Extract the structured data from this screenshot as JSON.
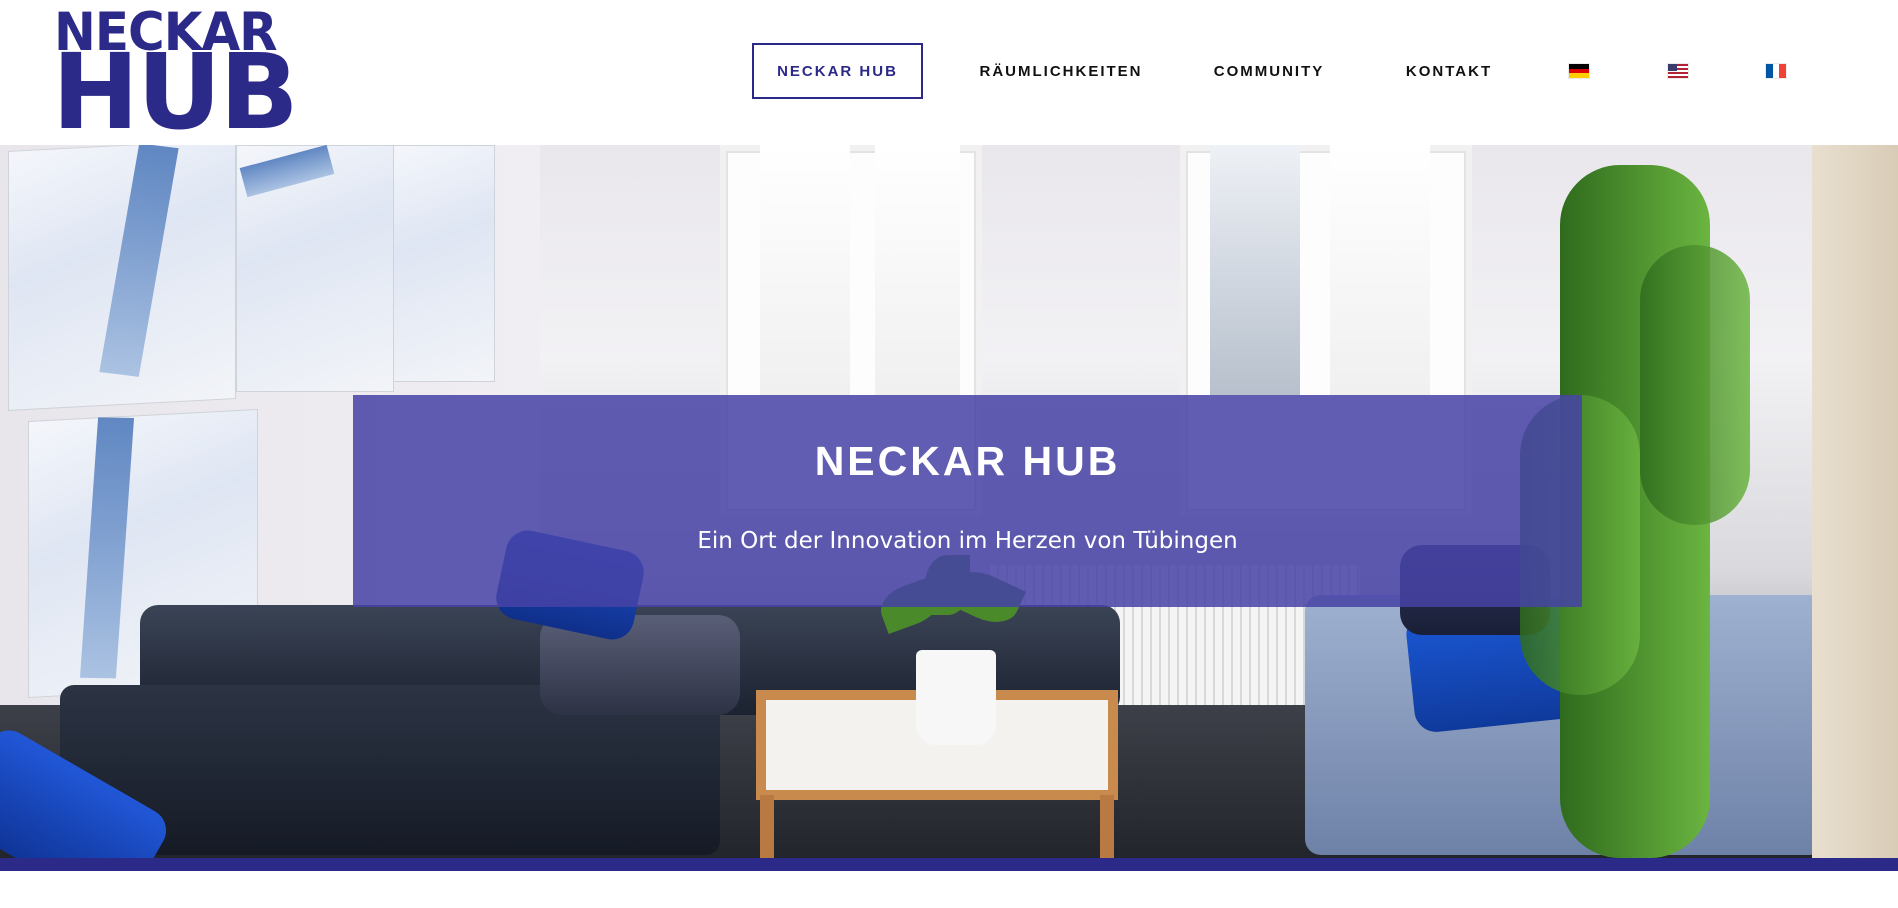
{
  "logo": {
    "line1": "NECKAR",
    "line2": "HUB",
    "color": "#2c2a88"
  },
  "nav": {
    "items": [
      {
        "label": "NECKAR HUB",
        "active": true
      },
      {
        "label": "RÄUMLICHKEITEN",
        "active": false
      },
      {
        "label": "COMMUNITY",
        "active": false
      },
      {
        "label": "KONTAKT",
        "active": false
      }
    ],
    "languages": [
      {
        "name": "de-flag-icon"
      },
      {
        "name": "us-flag-icon"
      },
      {
        "name": "fr-flag-icon"
      }
    ]
  },
  "hero": {
    "title": "NECKAR HUB",
    "subtitle": "Ein Ort der Innovation im Herzen von Tübingen",
    "overlay_color": "#4642a5"
  },
  "colors": {
    "brand": "#2c2a88",
    "text": "#111111"
  }
}
